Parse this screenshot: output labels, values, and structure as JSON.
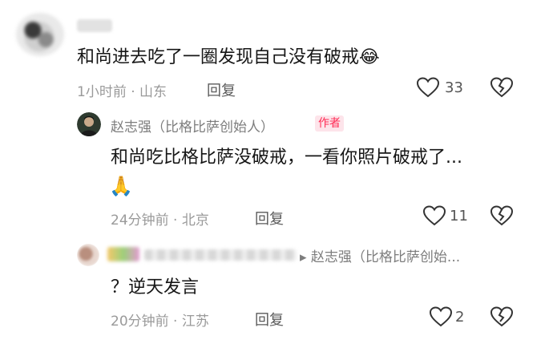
{
  "comment_main": {
    "text": "和尚进去吃了一圈发现自己没有破戒",
    "emoji": "😂",
    "time_location": "1小时前 · 山东",
    "reply_label": "回复",
    "likes": "33"
  },
  "reply_1": {
    "author": "赵志强（比格比萨创始人）",
    "tag": "作者",
    "text": "和尚吃比格比萨没破戒，一看你照片破戒了...",
    "emoji": "🙏",
    "time_location": "24分钟前 · 北京",
    "reply_label": "回复",
    "likes": "11"
  },
  "reply_2": {
    "reply_to": "▸ 赵志强（比格比萨创始...",
    "text": "？逆天发言",
    "time_location": "20分钟前 · 江苏",
    "reply_label": "回复",
    "likes": "2"
  },
  "colors": {
    "accent": "#ff2c55",
    "meta": "#9a9a9a",
    "tag_bg": "#fde4ea"
  }
}
